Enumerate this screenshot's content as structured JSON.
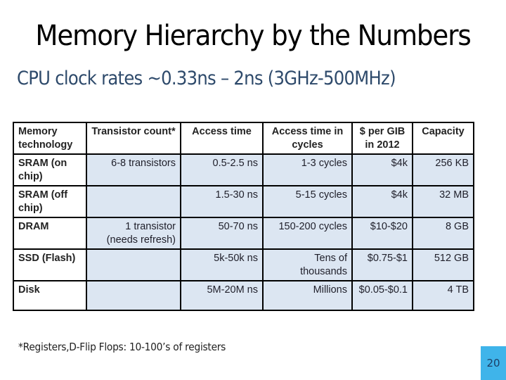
{
  "slide": {
    "title": "Memory Hierarchy by the Numbers",
    "subtitle": "CPU clock rates ~0.33ns – 2ns (3GHz-500MHz)",
    "footnote": "*Registers,D-Flip Flops: 10-100’s of registers",
    "page_number": "20"
  },
  "table": {
    "headers": [
      "Memory technology",
      "Transistor count*",
      "Access time",
      "Access time in cycles",
      "$ per GIB in 2012",
      "Capacity"
    ],
    "rows": [
      [
        "SRAM (on chip)",
        "6-8 transistors",
        "0.5-2.5 ns",
        "1-3 cycles",
        "$4k",
        "256 KB"
      ],
      [
        "SRAM (off chip)",
        "",
        "1.5-30 ns",
        "5-15 cycles",
        "$4k",
        "32 MB"
      ],
      [
        "DRAM",
        "1 transistor (needs refresh)",
        "50-70 ns",
        "150-200 cycles",
        "$10-$20",
        "8 GB"
      ],
      [
        "SSD (Flash)",
        "",
        "5k-50k ns",
        "Tens of thousands",
        "$0.75-$1",
        "512 GB"
      ],
      [
        "Disk",
        "",
        "5M-20M ns",
        "Millions",
        "$0.05-$0.1",
        "4 TB"
      ]
    ]
  },
  "colors": {
    "subtitle": "#2e4a6b",
    "cell_fill": "#dce6f2",
    "page_badge": "#3fb4ea"
  }
}
